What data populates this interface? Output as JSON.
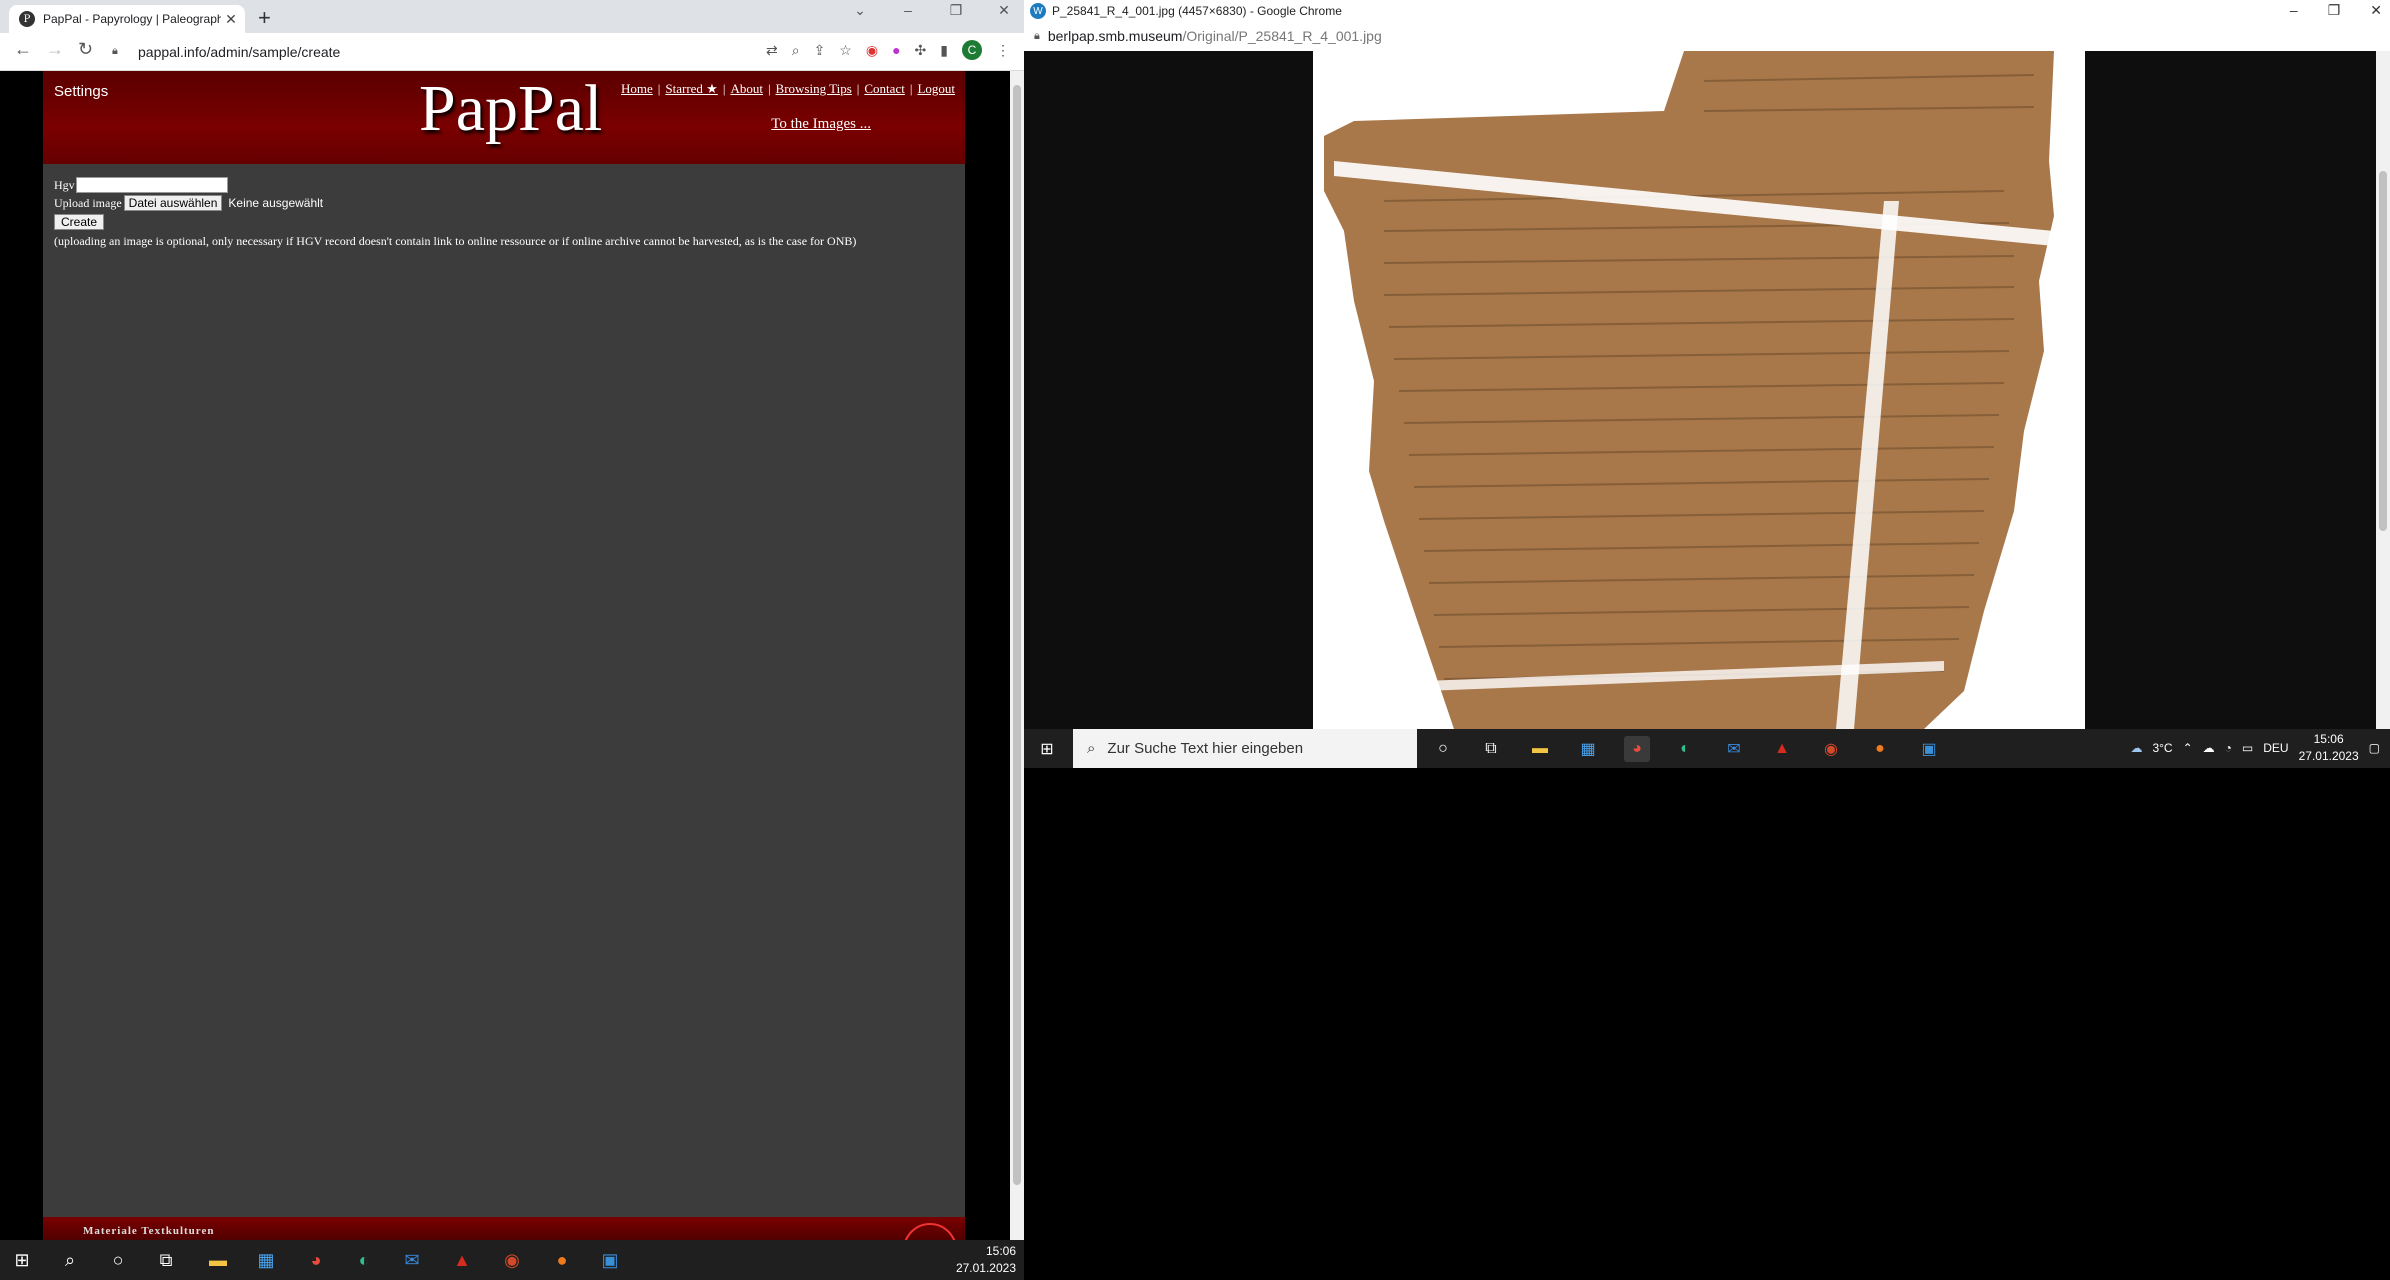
{
  "left_browser": {
    "tab_title": "PapPal - Papyrology | Paleograph",
    "tab_favicon": "P",
    "url": "pappal.info/admin/sample/create",
    "avatar_letter": "C"
  },
  "pappal": {
    "settings": "Settings",
    "logo": "PapPal",
    "nav": [
      "Home",
      "Starred ★",
      "About",
      "Browsing Tips",
      "Contact",
      "Logout"
    ],
    "to_images": "To the Images ...",
    "form": {
      "hgv_label": "Hgv",
      "upload_label": "Upload image",
      "file_button": "Datei auswählen",
      "file_status": "Keine ausgewählt",
      "create_button": "Create",
      "hint": "(uploading an image is optional, only necessary if HGV record doesn't contain link to online ressource or if online archive cannot be harvested, as is the case for ONB)"
    },
    "footer_text": "Materiale Textkulturen"
  },
  "left_taskbar": {
    "time": "15:06",
    "date": "27.01.2023"
  },
  "right_browser": {
    "window_title": "P_25841_R_4_001.jpg (4457×6830) - Google Chrome",
    "url_host": "berlpap.smb.museum",
    "url_path": "/Original/P_25841_R_4_001.jpg"
  },
  "right_taskbar": {
    "search_placeholder": "Zur Suche Text hier eingeben",
    "weather": "3°C",
    "language": "DEU",
    "time": "15:06",
    "date": "27.01.2023"
  },
  "colors": {
    "header_red": "#7a0000",
    "page_bg": "#3c3c3c",
    "papyrus": "#a8784a"
  }
}
